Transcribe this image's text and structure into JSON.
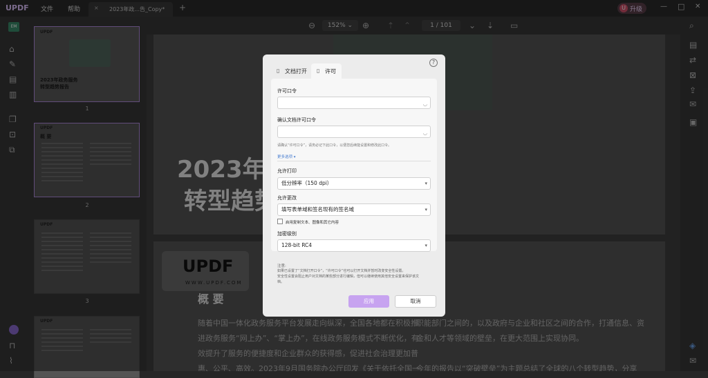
{
  "app": {
    "logo": "UPDF",
    "menu": [
      "文件",
      "帮助"
    ],
    "tab_title": "2023年政...告_Copy*",
    "tab_add": "+",
    "upgrade_label": "升级",
    "avatar_letter": "U",
    "window_controls": {
      "minimize": "—",
      "maximize": "□",
      "close": "✕"
    }
  },
  "toolbar": {
    "zoom_out": "⊖",
    "zoom_level": "152%",
    "zoom_in": "⊕",
    "page_current": "1",
    "page_sep": "/",
    "page_total": "101"
  },
  "thumbnails": [
    {
      "title": "2023年政务服务\n转型趋势报告",
      "label": "1"
    },
    {
      "title": "概 要",
      "label": "2"
    },
    {
      "title": "",
      "label": "3"
    },
    {
      "title": "",
      "label": ""
    }
  ],
  "document": {
    "heading_line1": "2023年政",
    "heading_line2": "转型趋势",
    "logo": "UPDF",
    "logo_url": "WWW.UPDF.COM",
    "section_title": "概 要",
    "para_left": [
      "随着中国一体化政务服务平台发展走向纵深，全国各地都在积极推",
      "进政务服务“网上办”、“掌上办”，在线政务服务模式不断优化，有",
      "效提升了服务的便捷度和企业群众的获得感，促进社会治理更加普",
      "惠、公平、高效。2023年9月国务院办公厅印发《关于依托全国一体"
    ],
    "para_right": [
      "职能部门之间的，以及政府与企业和社区之间的合作，打通信息、资",
      "金和人才等领域的壁垒，在更大范围上实现协同。",
      "",
      "今年的报告以“突破壁垒”为主题总结了全球的八个转型趋势，分享"
    ]
  },
  "dialog": {
    "help_icon": "?",
    "tab_open": "文档打开",
    "tab_permission": "许可",
    "permission_password_label": "许可口令",
    "permission_password_value": "",
    "confirm_label": "确认文档许可口令",
    "confirm_value": "",
    "hint": "请确认“许可口令”，请务必记下此口令，以便您后续能设置和修改此口令。",
    "more_settings": "更多选项",
    "allow_print_label": "允许打印",
    "allow_print_value": "低分辨率（150 dpi）",
    "allow_change_label": "允许更改",
    "allow_change_value": "填写表单域和签名现有的签名域",
    "copy_checkbox_label": "启用复制文本、图像和其它内容",
    "encryption_label": "加密级别",
    "encryption_value": "128-bit RC4",
    "note_title": "注意:",
    "note_line1": "如果已设置了“文档打开口令”，“许可口令”也可以打开文档并暂时改变安全性设置。",
    "note_line2": "安全性设置会阻止用户对文档的某些部分进行编辑，但可以继续使用其他安全设置来保护该文",
    "note_line3": "档。",
    "apply": "应用",
    "cancel": "取消"
  },
  "colors": {
    "accent": "#c7a3f0",
    "apply_btn": "#c7a3f0",
    "selected_border": "#b28de0"
  }
}
